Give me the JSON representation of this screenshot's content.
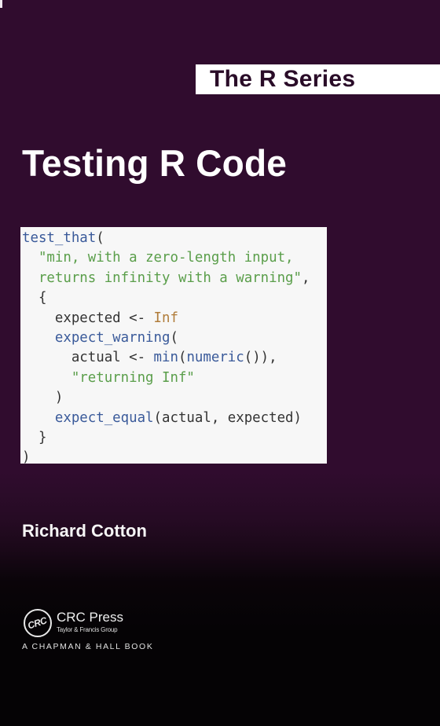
{
  "cover": {
    "series": "The R Series",
    "title": "Testing R Code",
    "author": "Richard Cotton",
    "colors": {
      "background": "#300c2e",
      "background_bottom": "#050305",
      "code_background": "#f7f7f7",
      "code_function": "#3a5a9a",
      "code_string": "#5a9e4a",
      "code_constant": "#b07c3a",
      "code_plain": "#333333"
    }
  },
  "code": {
    "lines": [
      [
        {
          "t": "test_that",
          "c": "fn"
        },
        {
          "t": "(",
          "c": "plain"
        }
      ],
      [
        {
          "t": "  ",
          "c": "plain"
        },
        {
          "t": "\"min, with a zero-length input,",
          "c": "str"
        }
      ],
      [
        {
          "t": "  ",
          "c": "plain"
        },
        {
          "t": "returns infinity with a warning\"",
          "c": "str"
        },
        {
          "t": ",",
          "c": "plain"
        }
      ],
      [
        {
          "t": "  {",
          "c": "plain"
        }
      ],
      [
        {
          "t": "    expected <- ",
          "c": "plain"
        },
        {
          "t": "Inf",
          "c": "num"
        }
      ],
      [
        {
          "t": "    ",
          "c": "plain"
        },
        {
          "t": "expect_warning",
          "c": "fn"
        },
        {
          "t": "(",
          "c": "plain"
        }
      ],
      [
        {
          "t": "      actual <- ",
          "c": "plain"
        },
        {
          "t": "min",
          "c": "fn"
        },
        {
          "t": "(",
          "c": "plain"
        },
        {
          "t": "numeric",
          "c": "fn"
        },
        {
          "t": "()),",
          "c": "plain"
        }
      ],
      [
        {
          "t": "      ",
          "c": "plain"
        },
        {
          "t": "\"returning Inf\"",
          "c": "str"
        }
      ],
      [
        {
          "t": "    )",
          "c": "plain"
        }
      ],
      [
        {
          "t": "    ",
          "c": "plain"
        },
        {
          "t": "expect_equal",
          "c": "fn"
        },
        {
          "t": "(actual, expected)",
          "c": "plain"
        }
      ],
      [
        {
          "t": "  }",
          "c": "plain"
        }
      ],
      [
        {
          "t": ")",
          "c": "plain"
        }
      ]
    ]
  },
  "publisher": {
    "logo_text": "CRC",
    "name": "CRC Press",
    "group": "Taylor & Francis Group",
    "imprint": "A CHAPMAN & HALL BOOK",
    "logo_icon": "crc-circle-logo"
  }
}
